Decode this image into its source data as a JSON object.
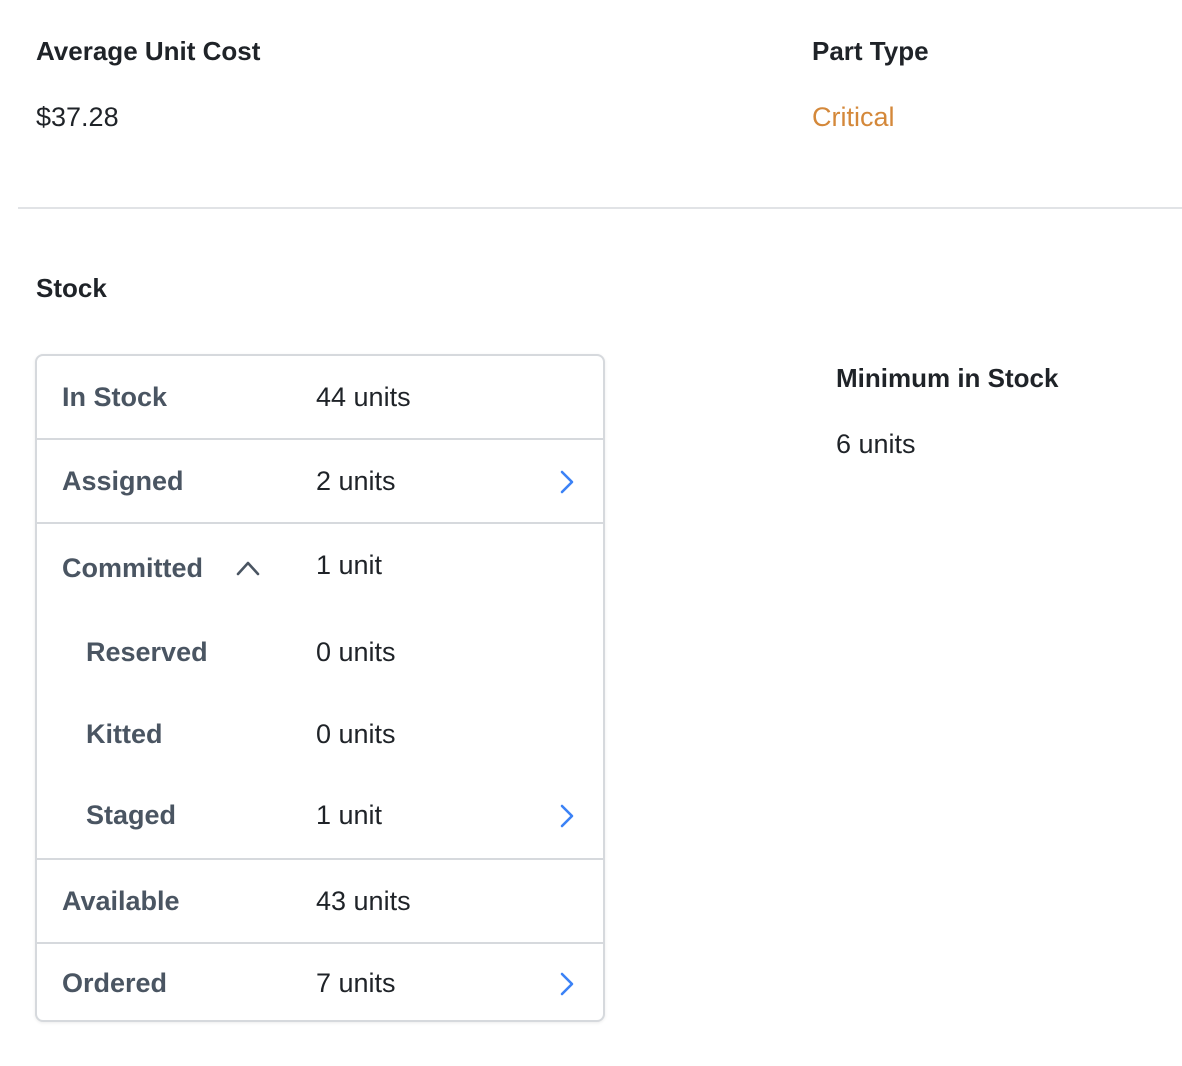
{
  "summary": {
    "average_unit_cost_label": "Average Unit Cost",
    "average_unit_cost_value": "$37.28",
    "part_type_label": "Part Type",
    "part_type_value": "Critical",
    "part_type_color": "#d4883a"
  },
  "stock": {
    "title": "Stock",
    "rows": {
      "in_stock": {
        "label": "In Stock",
        "value": "44 units"
      },
      "assigned": {
        "label": "Assigned",
        "value": "2 units",
        "icon": "chevron-right-icon"
      },
      "committed": {
        "label": "Committed",
        "value": "1 unit",
        "icon": "chevron-up-icon"
      },
      "reserved": {
        "label": "Reserved",
        "value": "0 units"
      },
      "kitted": {
        "label": "Kitted",
        "value": "0 units"
      },
      "staged": {
        "label": "Staged",
        "value": "1 unit",
        "icon": "chevron-right-icon"
      },
      "available": {
        "label": "Available",
        "value": "43 units"
      },
      "ordered": {
        "label": "Ordered",
        "value": "7 units",
        "icon": "chevron-right-icon"
      }
    },
    "minimum_label": "Minimum in Stock",
    "minimum_value": "6 units"
  },
  "colors": {
    "accent_link": "#3b82f6",
    "label_muted": "#4a5562",
    "border": "#d6d9dd"
  }
}
